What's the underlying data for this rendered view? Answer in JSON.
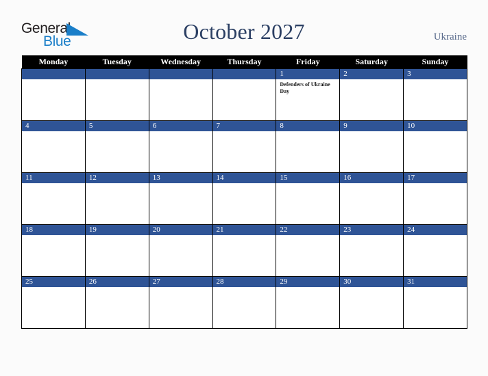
{
  "branding": {
    "logo_text_primary": "General",
    "logo_text_secondary": "Blue",
    "logo_triangle_icon": "triangle-icon",
    "primary_color": "#1a7ec8",
    "text_color": "#231f20"
  },
  "header": {
    "title": "October 2027",
    "country": "Ukraine",
    "title_color": "#2b3f63",
    "country_color": "#5a6b8c"
  },
  "calendar": {
    "month": "October",
    "year": "2027",
    "header_bg": "#000000",
    "date_band_color": "#2f5496",
    "weekday_headers": [
      "Monday",
      "Tuesday",
      "Wednesday",
      "Thursday",
      "Friday",
      "Saturday",
      "Sunday"
    ],
    "weeks": [
      [
        {
          "date": "",
          "events": []
        },
        {
          "date": "",
          "events": []
        },
        {
          "date": "",
          "events": []
        },
        {
          "date": "",
          "events": []
        },
        {
          "date": "1",
          "events": [
            "Defenders of Ukraine Day"
          ]
        },
        {
          "date": "2",
          "events": []
        },
        {
          "date": "3",
          "events": []
        }
      ],
      [
        {
          "date": "4",
          "events": []
        },
        {
          "date": "5",
          "events": []
        },
        {
          "date": "6",
          "events": []
        },
        {
          "date": "7",
          "events": []
        },
        {
          "date": "8",
          "events": []
        },
        {
          "date": "9",
          "events": []
        },
        {
          "date": "10",
          "events": []
        }
      ],
      [
        {
          "date": "11",
          "events": []
        },
        {
          "date": "12",
          "events": []
        },
        {
          "date": "13",
          "events": []
        },
        {
          "date": "14",
          "events": []
        },
        {
          "date": "15",
          "events": []
        },
        {
          "date": "16",
          "events": []
        },
        {
          "date": "17",
          "events": []
        }
      ],
      [
        {
          "date": "18",
          "events": []
        },
        {
          "date": "19",
          "events": []
        },
        {
          "date": "20",
          "events": []
        },
        {
          "date": "21",
          "events": []
        },
        {
          "date": "22",
          "events": []
        },
        {
          "date": "23",
          "events": []
        },
        {
          "date": "24",
          "events": []
        }
      ],
      [
        {
          "date": "25",
          "events": []
        },
        {
          "date": "26",
          "events": []
        },
        {
          "date": "27",
          "events": []
        },
        {
          "date": "28",
          "events": []
        },
        {
          "date": "29",
          "events": []
        },
        {
          "date": "30",
          "events": []
        },
        {
          "date": "31",
          "events": []
        }
      ]
    ]
  }
}
